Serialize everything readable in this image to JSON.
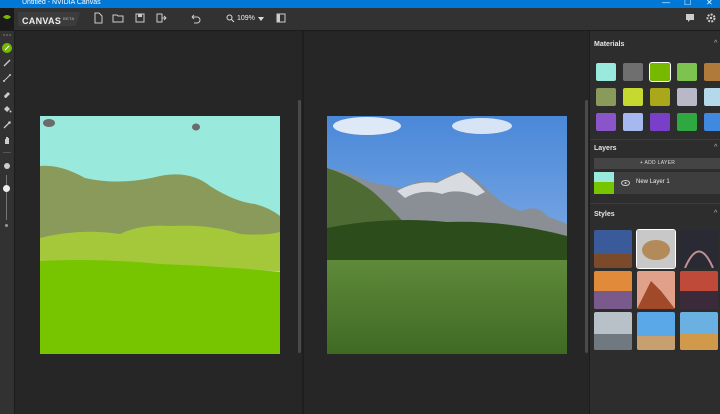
{
  "window": {
    "title": "Untitled - NVIDIA Canvas",
    "minimize": "—",
    "maximize": "☐",
    "close": "✕"
  },
  "toolbar": {
    "brand": "CANVAS",
    "badge": "BETA",
    "zoom": "109%"
  },
  "panel": {
    "materials_title": "Materials",
    "layers_title": "Layers",
    "add_layer": "+ ADD LAYER",
    "layer_name": "New Layer 1",
    "styles_title": "Styles"
  },
  "colors": {
    "accent": "#76b900",
    "sky_material": "#99eadd",
    "mountain_material": "#8a9a5b",
    "hill_material": "#a5c83a",
    "grass_material": "#76c500",
    "rock_material": "#6b6b6b"
  }
}
